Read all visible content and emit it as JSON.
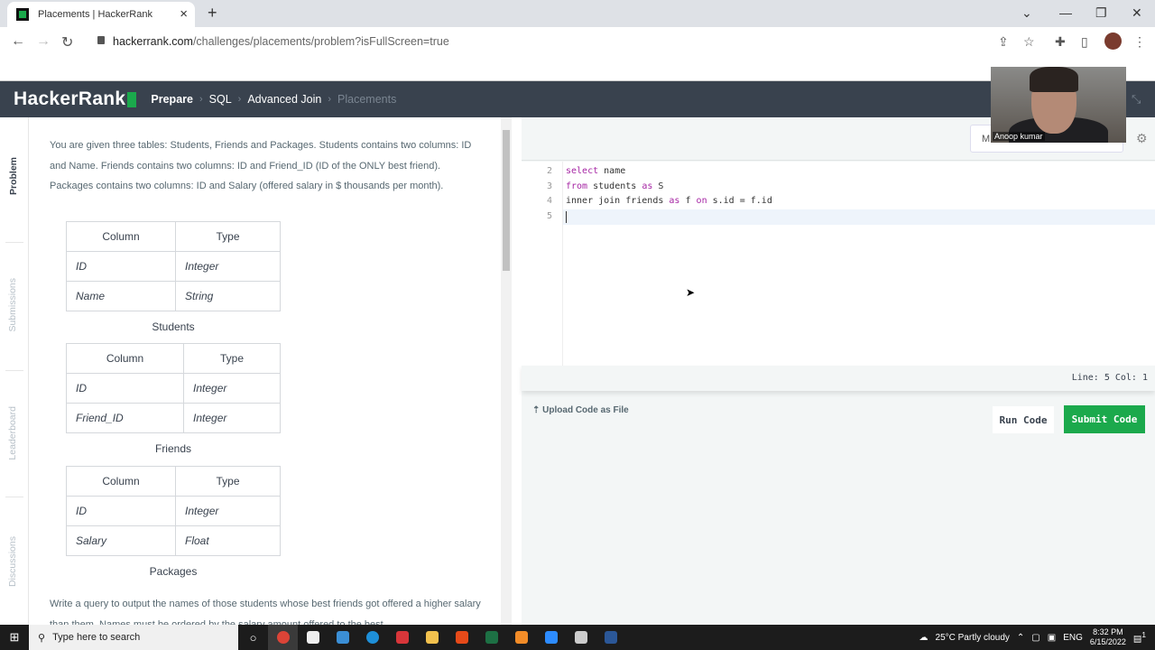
{
  "browser": {
    "tab_title": "Placements | HackerRank",
    "url_domain": "hackerrank.com",
    "url_path": "/challenges/placements/problem?isFullScreen=true"
  },
  "header": {
    "logo": "HackerRank",
    "breadcrumbs": [
      "Prepare",
      "SQL",
      "Advanced Join",
      "Placements"
    ]
  },
  "sidebar": {
    "tabs": [
      "Problem",
      "Submissions",
      "Leaderboard",
      "Discussions"
    ]
  },
  "problem": {
    "intro": "You are given three tables: Students, Friends and Packages. Students contains two columns: ID and Name. Friends contains two columns: ID and Friend_ID (ID of the ONLY best friend). Packages contains two columns: ID and Salary (offered salary in $ thousands per month).",
    "tables": [
      {
        "caption": "Students",
        "headers": [
          "Column",
          "Type"
        ],
        "rows": [
          [
            "ID",
            "Integer"
          ],
          [
            "Name",
            "String"
          ]
        ]
      },
      {
        "caption": "Friends",
        "headers": [
          "Column",
          "Type"
        ],
        "rows": [
          [
            "ID",
            "Integer"
          ],
          [
            "Friend_ID",
            "Integer"
          ]
        ]
      },
      {
        "caption": "Packages",
        "headers": [
          "Column",
          "Type"
        ],
        "rows": [
          [
            "ID",
            "Integer"
          ],
          [
            "Salary",
            "Float"
          ]
        ]
      }
    ],
    "task": "Write a query to output the names of those students whose best friends got offered a higher salary than them. Names must be ordered by the salary amount offered to the best"
  },
  "editor": {
    "language_partial": "M",
    "lines": [
      {
        "n": "2",
        "tokens": [
          [
            "kw",
            "select"
          ],
          [
            "",
            "name"
          ]
        ]
      },
      {
        "n": "3",
        "tokens": [
          [
            "kw",
            "from"
          ],
          [
            "",
            "students"
          ],
          [
            "kw",
            "as"
          ],
          [
            "",
            "S"
          ]
        ]
      },
      {
        "n": "4",
        "tokens": [
          [
            "",
            "inner join friends"
          ],
          [
            "kw",
            "as"
          ],
          [
            "",
            "f"
          ],
          [
            "kw",
            "on"
          ],
          [
            "",
            "s.id = f.id"
          ]
        ]
      },
      {
        "n": "5",
        "tokens": []
      }
    ],
    "status": "Line: 5 Col: 1",
    "upload_label": "Upload Code as File",
    "run_label": "Run Code",
    "submit_label": "Submit Code"
  },
  "webcam": {
    "name": "Anoop kumar"
  },
  "taskbar": {
    "search_placeholder": "Type here to search",
    "weather": "25°C  Partly cloudy",
    "lang": "ENG",
    "time": "8:32 PM",
    "date": "6/15/2022",
    "notif_count": "1"
  },
  "colors": {
    "brand": "#1ba94c",
    "header_bg": "#39424e",
    "keyword": "#a626a4"
  }
}
